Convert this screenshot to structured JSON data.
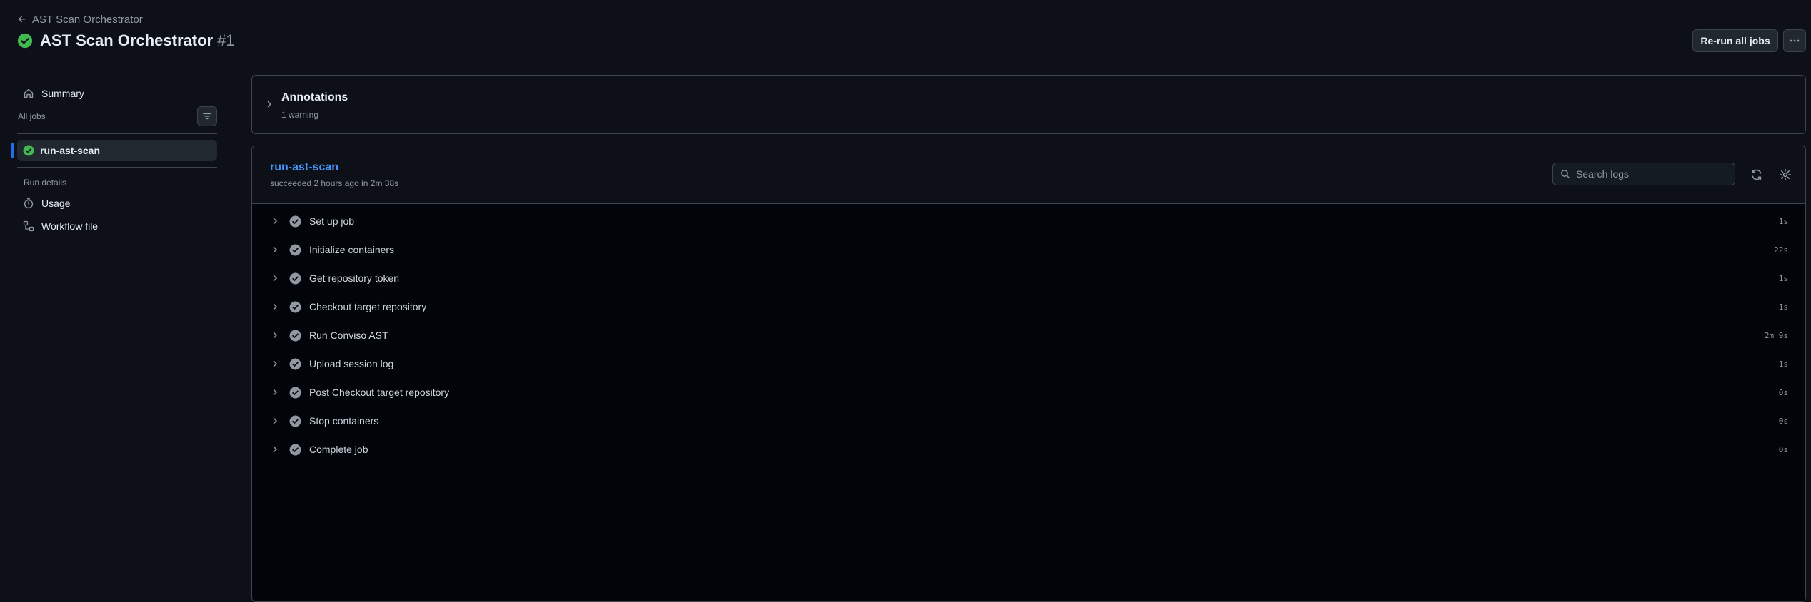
{
  "header": {
    "back_label": "AST Scan Orchestrator",
    "title": "AST Scan Orchestrator",
    "run_number": "#1",
    "rerun_label": "Re-run all jobs"
  },
  "sidebar": {
    "summary_label": "Summary",
    "all_jobs_label": "All jobs",
    "jobs": [
      {
        "label": "run-ast-scan",
        "status": "success"
      }
    ],
    "run_details_label": "Run details",
    "usage_label": "Usage",
    "workflow_file_label": "Workflow file"
  },
  "annotations": {
    "title": "Annotations",
    "subtitle": "1 warning"
  },
  "job": {
    "name": "run-ast-scan",
    "status_text": "succeeded 2 hours ago in 2m 38s",
    "search_placeholder": "Search logs",
    "steps": [
      {
        "label": "Set up job",
        "time": "1s"
      },
      {
        "label": "Initialize containers",
        "time": "22s"
      },
      {
        "label": "Get repository token",
        "time": "1s"
      },
      {
        "label": "Checkout target repository",
        "time": "1s"
      },
      {
        "label": "Run Conviso AST",
        "time": "2m 9s"
      },
      {
        "label": "Upload session log",
        "time": "1s"
      },
      {
        "label": "Post Checkout target repository",
        "time": "0s"
      },
      {
        "label": "Stop containers",
        "time": "0s"
      },
      {
        "label": "Complete job",
        "time": "0s"
      }
    ]
  },
  "colors": {
    "background": "#0d1117",
    "success": "#3fb950",
    "link": "#4493f8",
    "accent_bar": "#1f6feb"
  }
}
